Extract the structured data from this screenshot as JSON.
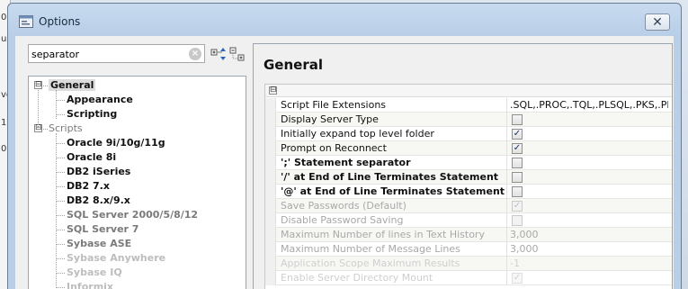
{
  "window": {
    "title": "Options",
    "close_glyph": "✕"
  },
  "background": {
    "edge_chars": [
      "0",
      "ue",
      "ve",
      "1.",
      "0"
    ]
  },
  "search": {
    "value": "separator",
    "clear_glyph": "×"
  },
  "tree": {
    "items": [
      {
        "label": "General",
        "bold": true,
        "selected": true,
        "style": "normal",
        "level": 0,
        "expander": "⊟"
      },
      {
        "label": "Appearance",
        "bold": true,
        "style": "normal",
        "level": 1
      },
      {
        "label": "Scripting",
        "bold": true,
        "style": "normal",
        "level": 1
      },
      {
        "label": "Scripts",
        "bold": false,
        "style": "grey",
        "level": 0,
        "expander": "⊟"
      },
      {
        "label": "Oracle 9i/10g/11g",
        "bold": true,
        "style": "normal",
        "level": 1
      },
      {
        "label": "Oracle 8i",
        "bold": true,
        "style": "normal",
        "level": 1
      },
      {
        "label": "DB2 iSeries",
        "bold": true,
        "style": "normal",
        "level": 1
      },
      {
        "label": "DB2 7.x",
        "bold": true,
        "style": "normal",
        "level": 1
      },
      {
        "label": "DB2 8.x/9.x",
        "bold": true,
        "style": "normal",
        "level": 1
      },
      {
        "label": "SQL Server 2000/5/8/12",
        "bold": true,
        "style": "grey",
        "level": 1
      },
      {
        "label": "SQL Server 7",
        "bold": true,
        "style": "grey",
        "level": 1
      },
      {
        "label": "Sybase ASE",
        "bold": true,
        "style": "grey",
        "level": 1
      },
      {
        "label": "Sybase Anywhere",
        "bold": true,
        "style": "faded",
        "level": 1
      },
      {
        "label": "Sybase IQ",
        "bold": true,
        "style": "faded",
        "level": 1
      },
      {
        "label": "Informix",
        "bold": true,
        "style": "faded",
        "level": 1
      }
    ]
  },
  "content": {
    "section_title": "General",
    "group_expander": "⊟",
    "rows": [
      {
        "name": "Script File Extensions",
        "bold": false,
        "type": "text",
        "value": ".SQL,.PROC,.TQL,.PLSQL,.PKS,.PKB,.PRC",
        "state": "normal"
      },
      {
        "name": "Display Server Type",
        "bold": false,
        "type": "check",
        "checked": false,
        "state": "normal"
      },
      {
        "name": "Initially expand top level folder",
        "bold": false,
        "type": "check",
        "checked": true,
        "state": "normal"
      },
      {
        "name": "Prompt on Reconnect",
        "bold": false,
        "type": "check",
        "checked": true,
        "state": "normal"
      },
      {
        "name": "';' Statement separator",
        "bold": true,
        "type": "check",
        "checked": false,
        "state": "normal"
      },
      {
        "name": "'/' at End of Line Terminates Statement",
        "bold": true,
        "type": "check",
        "checked": false,
        "state": "normal"
      },
      {
        "name": "'@' at End of Line Terminates Statement",
        "bold": true,
        "type": "check",
        "checked": false,
        "state": "normal"
      },
      {
        "name": "Save Passwords (Default)",
        "bold": false,
        "type": "check",
        "checked": true,
        "state": "disabled"
      },
      {
        "name": "Disable Password Saving",
        "bold": false,
        "type": "check",
        "checked": false,
        "state": "disabled"
      },
      {
        "name": "Maximum Number of lines in Text History",
        "bold": false,
        "type": "text",
        "value": "3,000",
        "state": "disabled"
      },
      {
        "name": "Maximum Number of Message Lines",
        "bold": false,
        "type": "text",
        "value": "3,000",
        "state": "disabled"
      },
      {
        "name": "Application Scope Maximum Results",
        "bold": false,
        "type": "text",
        "value": "-1",
        "state": "faded"
      },
      {
        "name": "Enable Server Directory Mount",
        "bold": false,
        "type": "check",
        "checked": true,
        "state": "faded"
      }
    ]
  },
  "icons": {
    "window_icon": "options-window-icon",
    "expand_all": "expand-all-icon",
    "collapse_all": "collapse-all-icon"
  }
}
